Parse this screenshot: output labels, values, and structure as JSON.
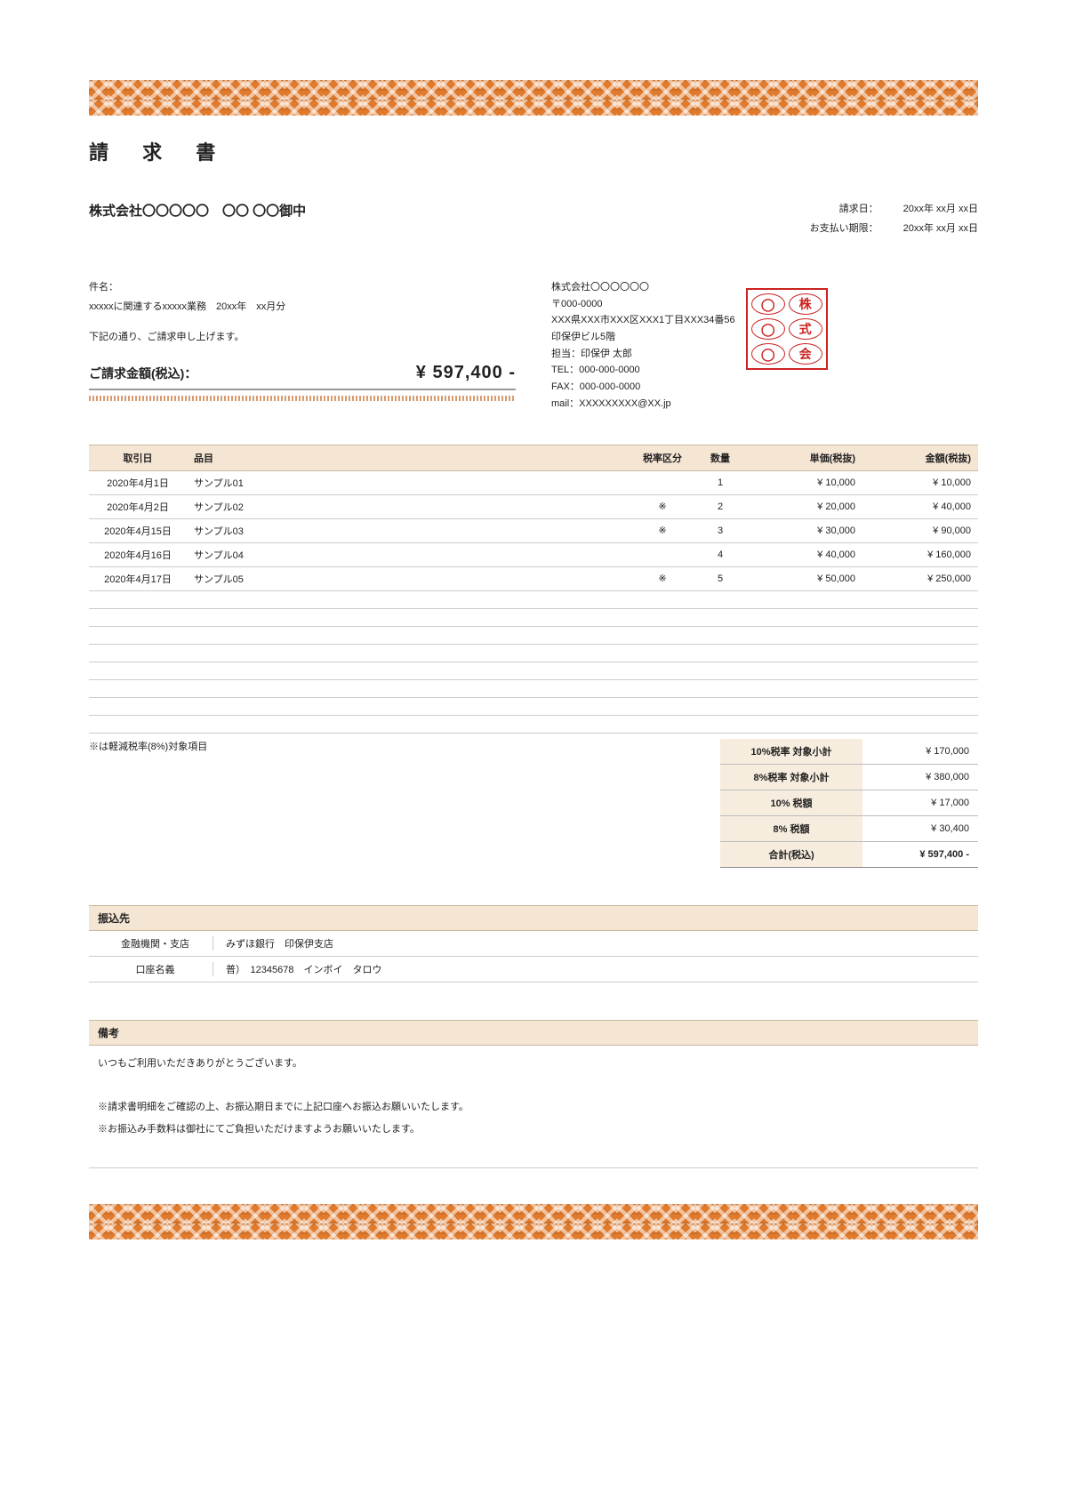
{
  "title": "請 求 書",
  "client": "株式会社〇〇〇〇〇　〇〇 〇〇御中",
  "dates": {
    "issue_label": "請求日：",
    "issue_value": "20xx年 xx月 xx日",
    "due_label": "お支払い期限：",
    "due_value": "20xx年 xx月 xx日"
  },
  "subject_label": "件名：",
  "subject": "xxxxxに関連するxxxxx業務　20xx年　xx月分",
  "intro": "下記の通り、ご請求申し上げます。",
  "total_label": "ご請求金額(税込)：",
  "total_value": "¥ 597,400 -",
  "sender": {
    "company": "株式会社〇〇〇〇〇〇",
    "postal": "〒000-0000",
    "address": "XXX県XXX市XXX区XXX1丁目XXX34番56",
    "building": "印保伊ビル5階",
    "contact": "担当：印保伊 太郎",
    "tel": "TEL：000-000-0000",
    "fax": "FAX：000-000-0000",
    "mail": "mail：XXXXXXXXX@XX.jp"
  },
  "stamp": [
    "◯",
    "株",
    "◯",
    "式",
    "◯",
    "会"
  ],
  "headers": {
    "date": "取引日",
    "item": "品目",
    "tax": "税率区分",
    "qty": "数量",
    "unit": "単価(税抜)",
    "amt": "金額(税抜)"
  },
  "rows": [
    {
      "date": "2020年4月1日",
      "item": "サンプル01",
      "tax": "",
      "qty": "1",
      "unit": "¥ 10,000",
      "amt": "¥ 10,000"
    },
    {
      "date": "2020年4月2日",
      "item": "サンプル02",
      "tax": "※",
      "qty": "2",
      "unit": "¥ 20,000",
      "amt": "¥ 40,000"
    },
    {
      "date": "2020年4月15日",
      "item": "サンプル03",
      "tax": "※",
      "qty": "3",
      "unit": "¥ 30,000",
      "amt": "¥ 90,000"
    },
    {
      "date": "2020年4月16日",
      "item": "サンプル04",
      "tax": "",
      "qty": "4",
      "unit": "¥ 40,000",
      "amt": "¥ 160,000"
    },
    {
      "date": "2020年4月17日",
      "item": "サンプル05",
      "tax": "※",
      "qty": "5",
      "unit": "¥ 50,000",
      "amt": "¥ 250,000"
    }
  ],
  "empty_rows": 8,
  "tax_note": "※は軽減税率(8%)対象項目",
  "summary": [
    {
      "label": "10%税率 対象小計",
      "value": "¥ 170,000"
    },
    {
      "label": "8%税率 対象小計",
      "value": "¥ 380,000"
    },
    {
      "label": "10% 税額",
      "value": "¥ 17,000"
    },
    {
      "label": "8% 税額",
      "value": "¥ 30,400"
    }
  ],
  "summary_final": {
    "label": "合計(税込)",
    "value": "¥ 597,400 -"
  },
  "bank_header": "振込先",
  "bank": [
    {
      "label": "金融機関・支店",
      "value": "みずほ銀行　印保伊支店"
    },
    {
      "label": "口座名義",
      "value": "普）　12345678　インボイ　タロウ"
    }
  ],
  "notes_header": "備考",
  "notes": [
    "いつもご利用いただきありがとうございます。",
    "",
    "※請求書明細をご確認の上、お振込期日までに上記口座へお振込お願いいたします。",
    "※お振込み手数料は御社にてご負担いただけますようお願いいたします。"
  ]
}
